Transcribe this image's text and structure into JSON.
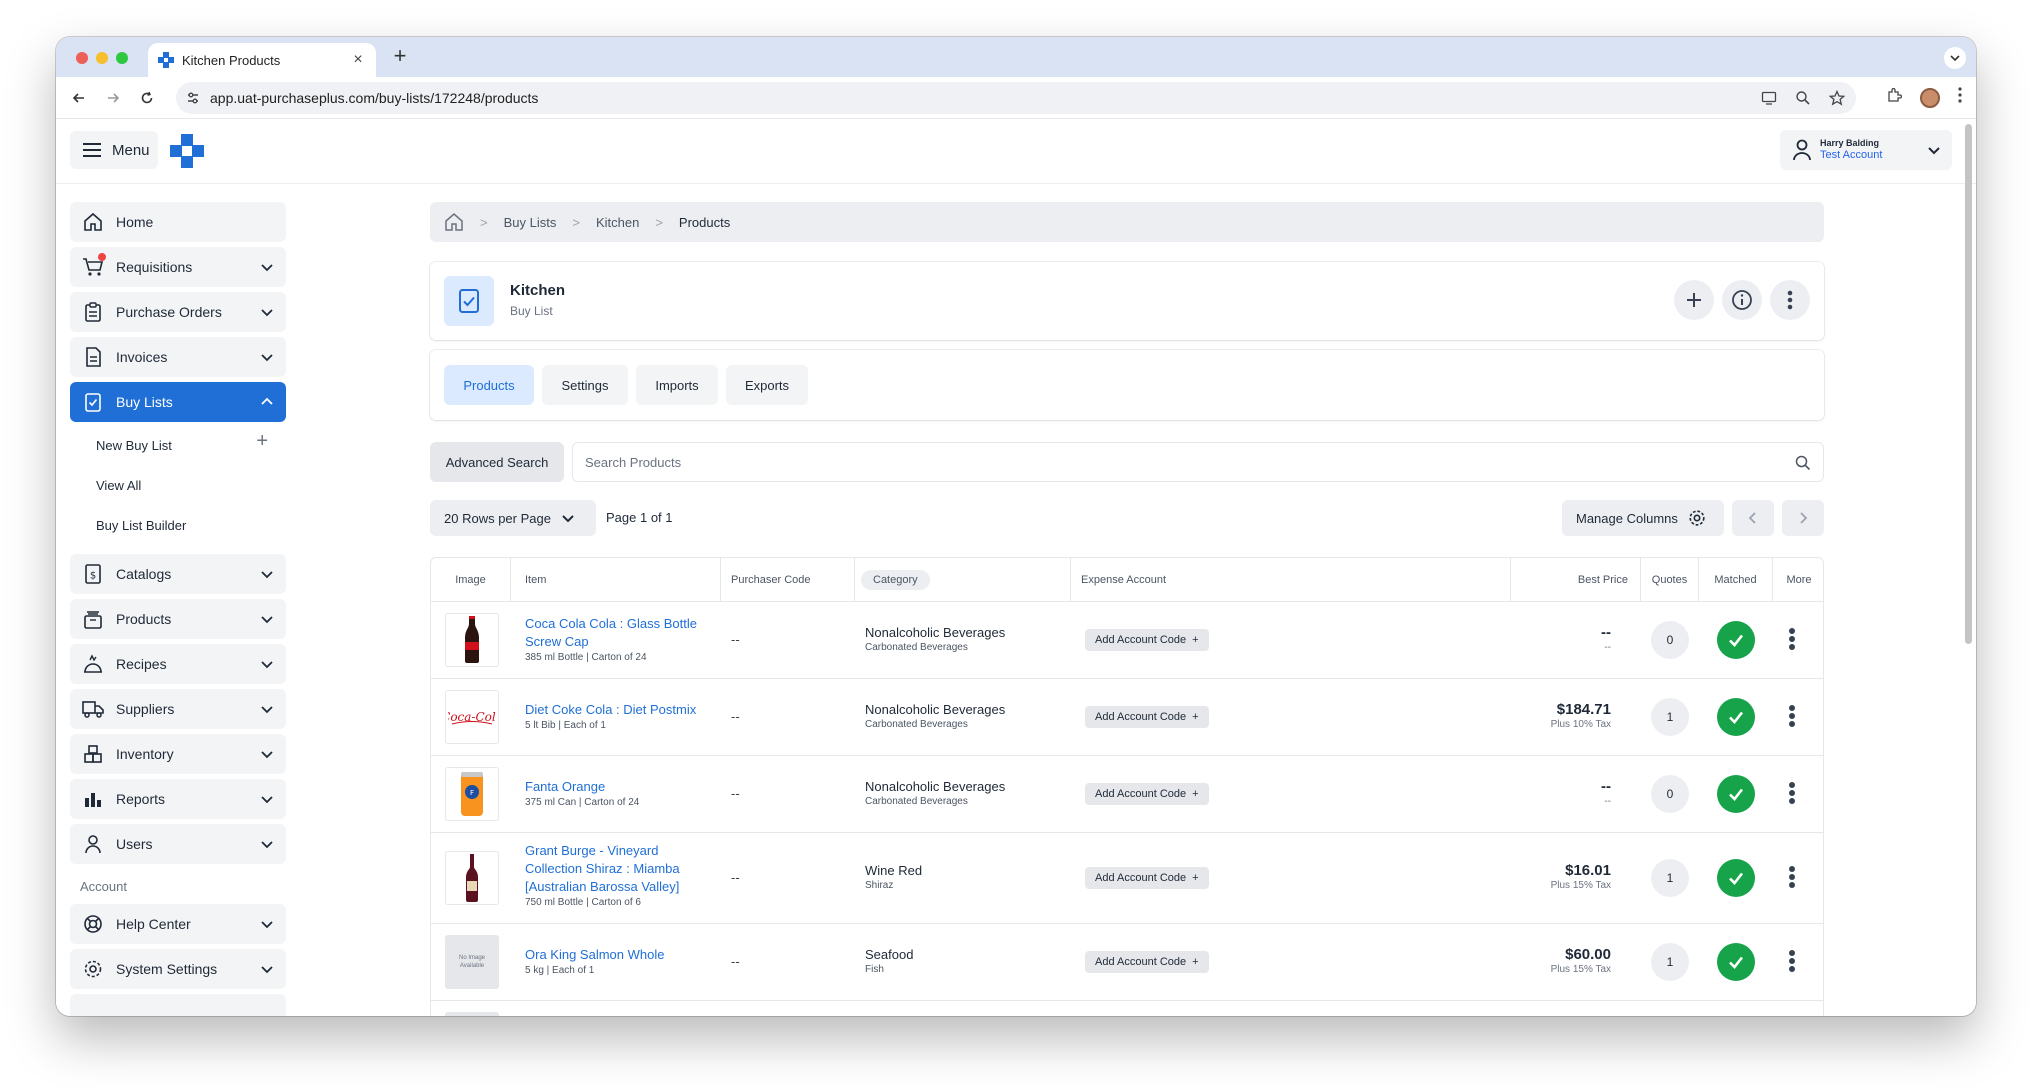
{
  "browser": {
    "tab_title": "Kitchen Products",
    "tab_close": "×",
    "new_tab": "+",
    "url": "app.uat-purchaseplus.com/buy-lists/172248/products"
  },
  "header": {
    "menu_label": "Menu",
    "user_name": "Harry Balding",
    "user_account": "Test Account"
  },
  "sidebar": {
    "items": [
      {
        "label": "Home",
        "icon": "home-icon"
      },
      {
        "label": "Requisitions",
        "icon": "cart-icon"
      },
      {
        "label": "Purchase Orders",
        "icon": "clipboard-icon"
      },
      {
        "label": "Invoices",
        "icon": "invoice-icon"
      },
      {
        "label": "Buy Lists",
        "icon": "buylist-icon"
      },
      {
        "label": "Catalogs",
        "icon": "catalog-icon"
      },
      {
        "label": "Products",
        "icon": "products-icon"
      },
      {
        "label": "Recipes",
        "icon": "recipes-icon"
      },
      {
        "label": "Suppliers",
        "icon": "truck-icon"
      },
      {
        "label": "Inventory",
        "icon": "inventory-icon"
      },
      {
        "label": "Reports",
        "icon": "chart-icon"
      },
      {
        "label": "Users",
        "icon": "user-icon"
      },
      {
        "label": "Help Center",
        "icon": "lifebuoy-icon"
      },
      {
        "label": "System Settings",
        "icon": "gear-icon"
      }
    ],
    "sub_items": [
      "New Buy List",
      "View All",
      "Buy List Builder"
    ],
    "section_account": "Account"
  },
  "breadcrumb": [
    "Buy Lists",
    "Kitchen",
    "Products"
  ],
  "title_card": {
    "title": "Kitchen",
    "subtitle": "Buy List"
  },
  "tabs": [
    "Products",
    "Settings",
    "Imports",
    "Exports"
  ],
  "search": {
    "advanced_label": "Advanced Search",
    "placeholder": "Search Products"
  },
  "pager": {
    "rows_label": "20 Rows per Page",
    "page_info": "Page 1 of 1",
    "manage_columns": "Manage Columns"
  },
  "table": {
    "headers": [
      "Image",
      "Item",
      "Purchaser Code",
      "Category",
      "Expense Account",
      "Best Price",
      "Quotes",
      "Matched",
      "More"
    ],
    "add_account_label": "Add Account Code",
    "rows": [
      {
        "name_lines": [
          "Coca Cola Cola : Glass Bottle",
          "Screw Cap"
        ],
        "sub": "385 ml Bottle | Carton of 24",
        "code": "--",
        "category": "Nonalcoholic Beverages",
        "subcategory": "Carbonated Beverages",
        "price": "--",
        "price_sub": "--",
        "quotes": "0",
        "thumb": "coke-bottle"
      },
      {
        "name_lines": [
          "Diet Coke Cola : Diet Postmix"
        ],
        "sub": "5 lt Bib | Each of 1",
        "code": "--",
        "category": "Nonalcoholic Beverages",
        "subcategory": "Carbonated Beverages",
        "price": "$184.71",
        "price_sub": "Plus 10% Tax",
        "quotes": "1",
        "thumb": "coca-cola-logo"
      },
      {
        "name_lines": [
          "Fanta Orange"
        ],
        "sub": "375 ml Can | Carton of 24",
        "code": "--",
        "category": "Nonalcoholic Beverages",
        "subcategory": "Carbonated Beverages",
        "price": "--",
        "price_sub": "--",
        "quotes": "0",
        "thumb": "fanta-can"
      },
      {
        "name_lines": [
          "Grant Burge - Vineyard",
          "Collection Shiraz : Miamba",
          "[Australian Barossa Valley]"
        ],
        "sub": "750 ml Bottle | Carton of 6",
        "code": "--",
        "category": "Wine Red",
        "subcategory": "Shiraz",
        "price": "$16.01",
        "price_sub": "Plus 15% Tax",
        "quotes": "1",
        "thumb": "wine-bottle"
      },
      {
        "name_lines": [
          "Ora King Salmon Whole"
        ],
        "sub": "5 kg | Each of 1",
        "code": "--",
        "category": "Seafood",
        "subcategory": "Fish",
        "price": "$60.00",
        "price_sub": "Plus 15% Tax",
        "quotes": "1",
        "thumb": "no-image",
        "thumb_text": "No Image Available"
      }
    ]
  },
  "colors": {
    "primary": "#1f6fd6",
    "matched": "#16a34a",
    "tab_active_bg": "#dbeafe"
  }
}
